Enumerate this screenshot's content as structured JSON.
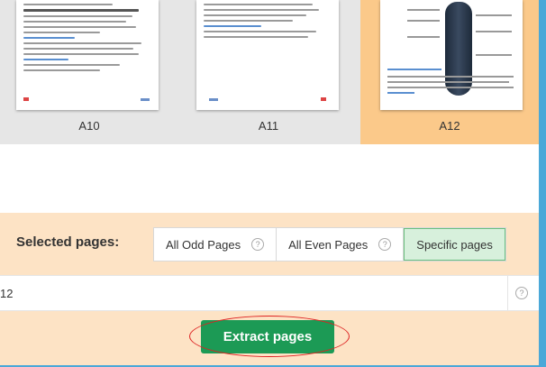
{
  "thumbnails": [
    {
      "label": "A10",
      "selected": false
    },
    {
      "label": "A11",
      "selected": false
    },
    {
      "label": "A12",
      "selected": true
    }
  ],
  "selection": {
    "label": "Selected pages:",
    "options": [
      {
        "label": "All Odd Pages",
        "help_icon": "question-icon",
        "active": false
      },
      {
        "label": "All Even Pages",
        "help_icon": "question-icon",
        "active": false
      },
      {
        "label": "Specific pages",
        "active": true
      }
    ]
  },
  "pages_input": {
    "value": "12",
    "help_icon": "question-icon"
  },
  "extract_button": {
    "label": "Extract pages"
  },
  "colors": {
    "selected_thumb": "#fbc98a",
    "band": "#fde3c5",
    "button": "#1c9a55",
    "active_option": "#d7f0dc",
    "annotation": "#d22222"
  }
}
